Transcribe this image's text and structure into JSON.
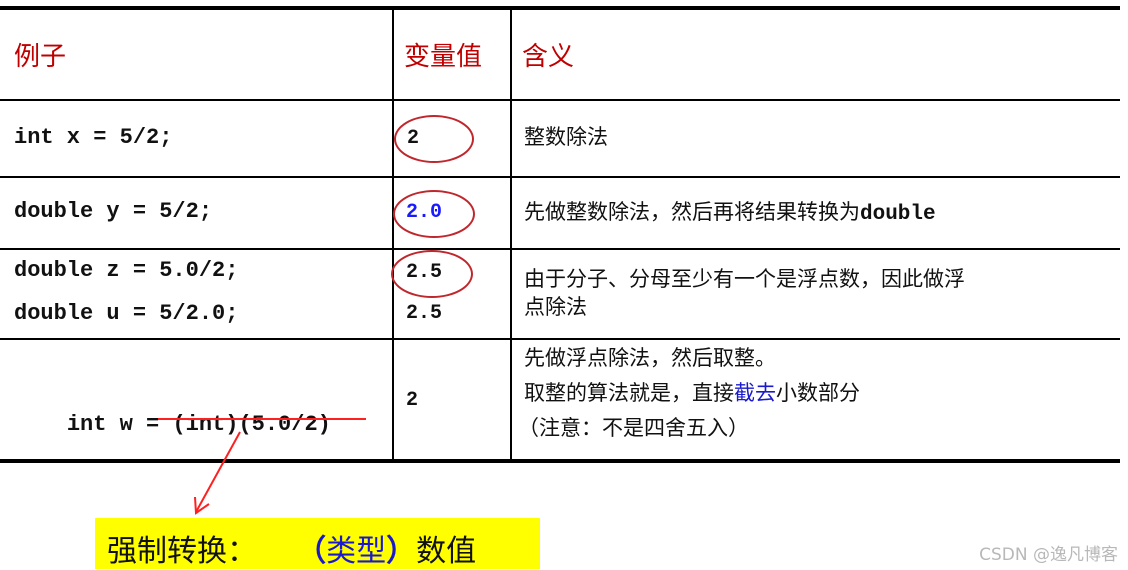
{
  "table": {
    "headers": {
      "example": "例子",
      "value": "变量值",
      "meaning": "含义"
    },
    "rows": [
      {
        "code_lines": [
          "int x = 5/2;"
        ],
        "values": [
          "2"
        ],
        "value_highlighted": true,
        "meaning_lines": [
          "整数除法"
        ]
      },
      {
        "code_lines": [
          "double y = 5/2;"
        ],
        "values": [
          "2.0"
        ],
        "value_highlighted": true,
        "value_color": "#1a1aff",
        "meaning_prefix": "先做整数除法，然后再将结果转换为",
        "meaning_mono": "double"
      },
      {
        "code_lines": [
          "double z = 5.0/2;",
          "double u = 5/2.0;"
        ],
        "values": [
          "2.5",
          "2.5"
        ],
        "value_highlighted": true,
        "meaning_lines": [
          "由于分子、分母至少有一个是浮点数，因此做浮",
          "点除法"
        ]
      },
      {
        "code_prefix": "int w = ",
        "code_underlined": "(int)(5.0/2)",
        "values": [
          "2"
        ],
        "meaning_line1": "先做浮点除法，然后取整。",
        "meaning_line2_before": "取整的算法就是，直接",
        "meaning_line2_highlight": "截去",
        "meaning_line2_after": "小数部分",
        "meaning_line3": "（注意：不是四舍五入）"
      }
    ]
  },
  "callout": {
    "label": "强制转换：",
    "open_paren": "（",
    "type": "类型",
    "close_paren": "）",
    "value": "数值"
  },
  "colors": {
    "header_red": "#c00000",
    "circle_red": "#c0272d",
    "accent_blue": "#1a1acc",
    "callout_bg": "#ffff00"
  },
  "watermark": "CSDN @逸凡博客"
}
